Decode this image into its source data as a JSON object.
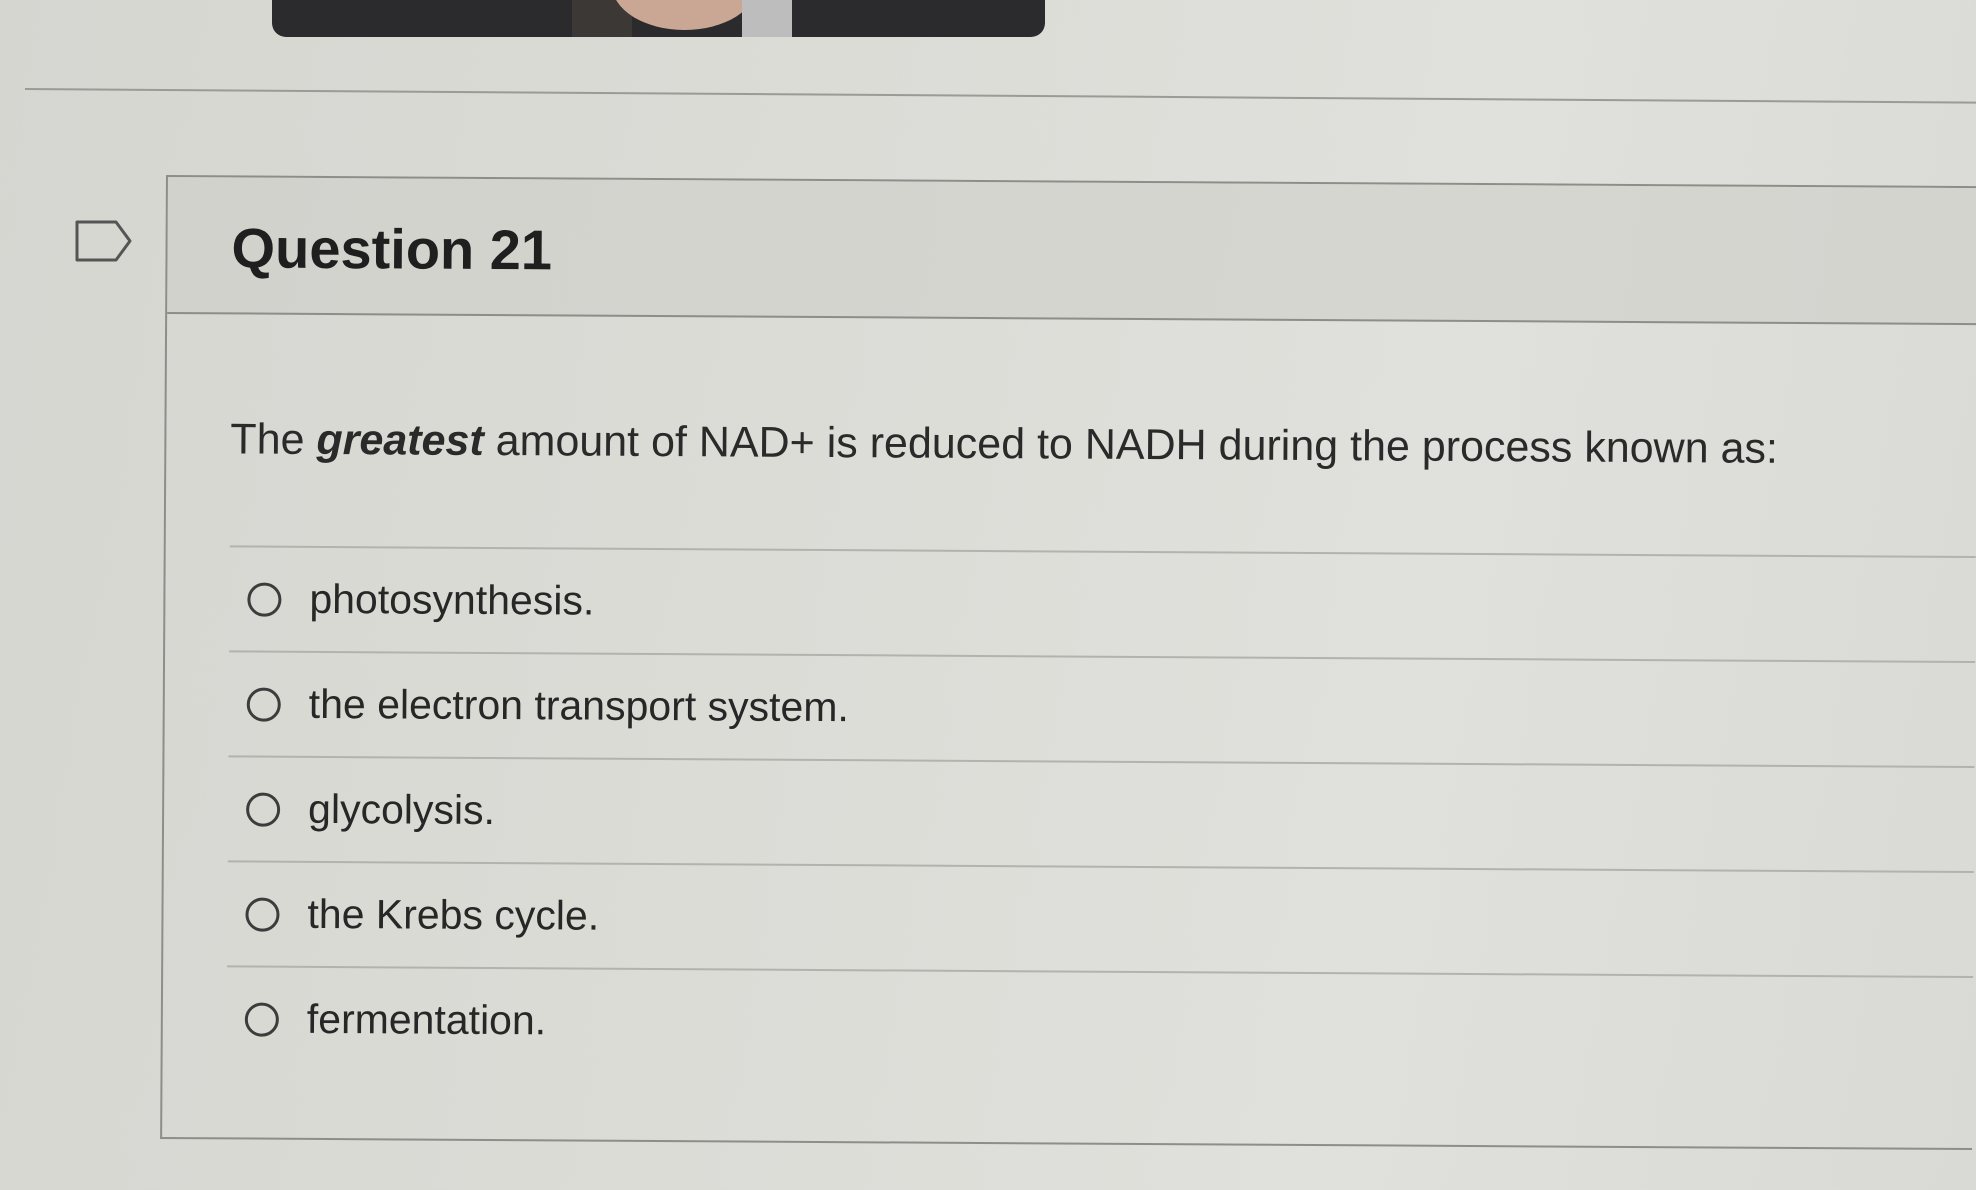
{
  "question": {
    "title": "Question 21",
    "text_before": "The ",
    "text_emphasis": "greatest",
    "text_after": " amount of NAD+ is reduced to NADH during the process known as:",
    "answers": [
      {
        "label": "photosynthesis.",
        "selected": false
      },
      {
        "label": "the electron transport system.",
        "selected": false
      },
      {
        "label": "glycolysis.",
        "selected": false
      },
      {
        "label": "the Krebs cycle.",
        "selected": false
      },
      {
        "label": "fermentation.",
        "selected": false
      }
    ]
  },
  "icons": {
    "flag": "flag-icon",
    "radio": "radio-button-icon"
  },
  "colors": {
    "background": "#dcdcd7",
    "header_background": "#d2d2cd",
    "border": "#8d8d89",
    "text": "#2a2a2a"
  }
}
